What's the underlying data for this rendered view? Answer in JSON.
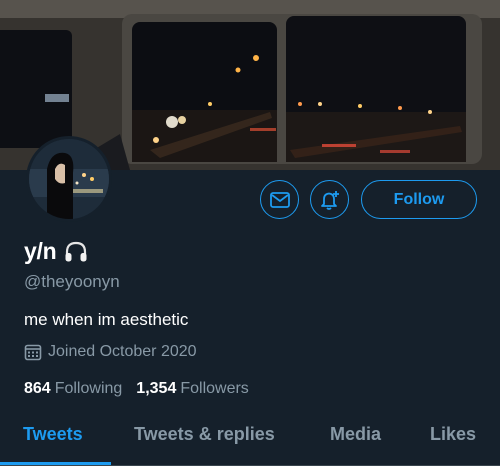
{
  "profile": {
    "display_name": "y/n",
    "name_emoji": "headphones-icon",
    "handle": "@theyoonyn",
    "bio": "me when im aesthetic",
    "joined": "Joined October 2020"
  },
  "actions": {
    "message_icon": "mail-icon",
    "notify_icon": "bell-plus-icon",
    "follow_label": "Follow"
  },
  "stats": {
    "following_count": "864",
    "following_label": "Following",
    "followers_count": "1,354",
    "followers_label": "Followers"
  },
  "tabs": [
    {
      "label": "Tweets",
      "active": true
    },
    {
      "label": "Tweets & replies",
      "active": false
    },
    {
      "label": "Media",
      "active": false
    },
    {
      "label": "Likes",
      "active": false
    }
  ],
  "colors": {
    "background": "#15202b",
    "accent": "#1d9bf0",
    "secondary_text": "#8899a6",
    "divider": "#38444d"
  }
}
